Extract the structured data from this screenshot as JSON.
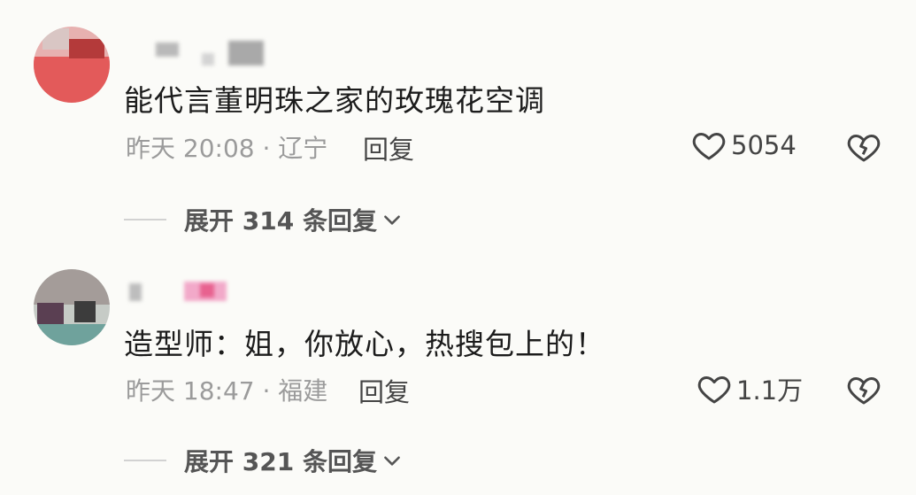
{
  "comments": [
    {
      "text": "能代言董明珠之家的玫瑰花空调",
      "meta": "昨天 20:08 · 辽宁",
      "reply_label": "回复",
      "like_count": "5054",
      "expand_label": "展开 314 条回复"
    },
    {
      "text": "造型师：姐，你放心，热搜包上的！",
      "meta": "昨天 18:47 · 福建",
      "reply_label": "回复",
      "like_count": "1.1万",
      "expand_label": "展开 321 条回复"
    }
  ],
  "icons": {
    "like": "heart-outline-icon",
    "dislike": "broken-heart-icon",
    "expand": "chevron-down-icon"
  },
  "colors": {
    "text": "#1c1c1c",
    "meta": "#9b9b9b",
    "action": "#444444"
  }
}
